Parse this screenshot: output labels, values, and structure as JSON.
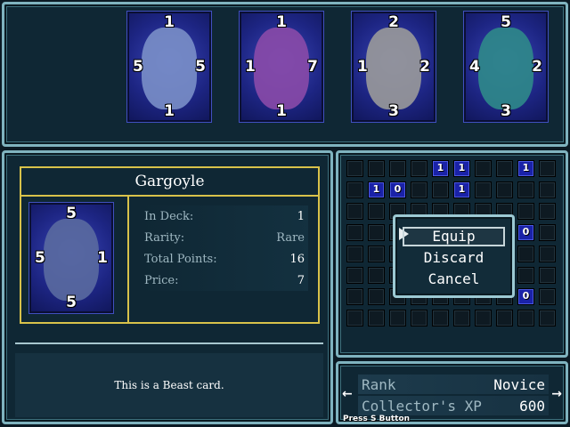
{
  "top_cards": [
    {
      "name": "card-1",
      "top": "1",
      "left": "5",
      "right": "5",
      "bottom": "1",
      "art_color": "#7a8fc8"
    },
    {
      "name": "card-2",
      "top": "1",
      "left": "1",
      "right": "7",
      "bottom": "1",
      "art_color": "#8a4aa8"
    },
    {
      "name": "card-3",
      "top": "2",
      "left": "1",
      "right": "2",
      "bottom": "3",
      "art_color": "#9a9a9a"
    },
    {
      "name": "card-4",
      "top": "5",
      "left": "4",
      "right": "2",
      "bottom": "3",
      "art_color": "#2f8a8a"
    }
  ],
  "detail": {
    "card_name": "Gargoyle",
    "card": {
      "top": "5",
      "left": "5",
      "right": "1",
      "bottom": "5",
      "art_color": "#5a6aa0"
    },
    "stats": [
      {
        "label": "In Deck:",
        "value": "1"
      },
      {
        "label": "Rarity:",
        "value": "Rare"
      },
      {
        "label": "Total Points:",
        "value": "16"
      },
      {
        "label": "Price:",
        "value": "7"
      }
    ],
    "description": "This is a Beast card."
  },
  "grid": {
    "owned": [
      {
        "row": 0,
        "col": 4,
        "count": "1"
      },
      {
        "row": 0,
        "col": 5,
        "count": "1"
      },
      {
        "row": 0,
        "col": 8,
        "count": "1"
      },
      {
        "row": 1,
        "col": 1,
        "count": "1"
      },
      {
        "row": 1,
        "col": 2,
        "count": "0"
      },
      {
        "row": 1,
        "col": 5,
        "count": "1"
      },
      {
        "row": 3,
        "col": 8,
        "count": "0"
      },
      {
        "row": 6,
        "col": 8,
        "count": "0"
      }
    ]
  },
  "menu": {
    "items": [
      "Equip",
      "Discard",
      "Cancel"
    ],
    "selected": "Equip"
  },
  "rank": {
    "rank_label": "Rank",
    "rank_value": "Novice",
    "xp_label": "Collector's XP",
    "xp_value": "600",
    "left_arrow": "←",
    "right_arrow": "→"
  },
  "hint": "Press S Button",
  "colors": {
    "frame": "#7fb3bf",
    "gold": "#d8c24a",
    "card_blue": "#1d2583"
  }
}
